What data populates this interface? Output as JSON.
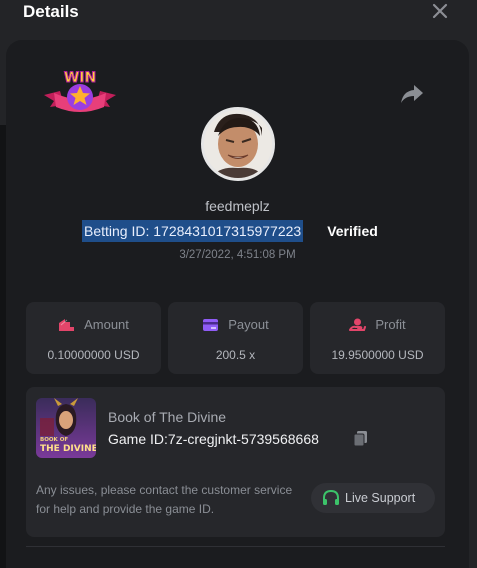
{
  "dialog": {
    "title": "Details"
  },
  "icons": {
    "close": "close-icon",
    "share": "share-icon",
    "badge": "win-badge-icon",
    "amount": "amount-icon",
    "payout": "card-icon",
    "profit": "profit-icon",
    "copy": "copy-icon",
    "support": "headset-icon"
  },
  "badge": {
    "text": "WIN"
  },
  "bet": {
    "username": "feedmeplz",
    "betting_id": "Betting ID: 1728431017315977223",
    "verified": "Verified",
    "datetime": "3/27/2022, 4:51:08 PM"
  },
  "stats": [
    {
      "label": "Amount",
      "value": "0.10000000 USD",
      "color": "#e2456a"
    },
    {
      "label": "Payout",
      "value": "200.5 x",
      "color": "#8f5cf5"
    },
    {
      "label": "Profit",
      "value": "19.9500000 USD",
      "color": "#e2456a"
    }
  ],
  "game": {
    "thumb_text_1": "BOOK OF",
    "thumb_text_2": "THE DIVINE",
    "name": "Book of The Divine",
    "id": "Game ID:7z-cregjnkt-5739568668"
  },
  "support": {
    "help_text": "Any issues, please contact the customer service for help and provide the game ID.",
    "button_label": "Live Support",
    "color": "#3cc36a"
  }
}
